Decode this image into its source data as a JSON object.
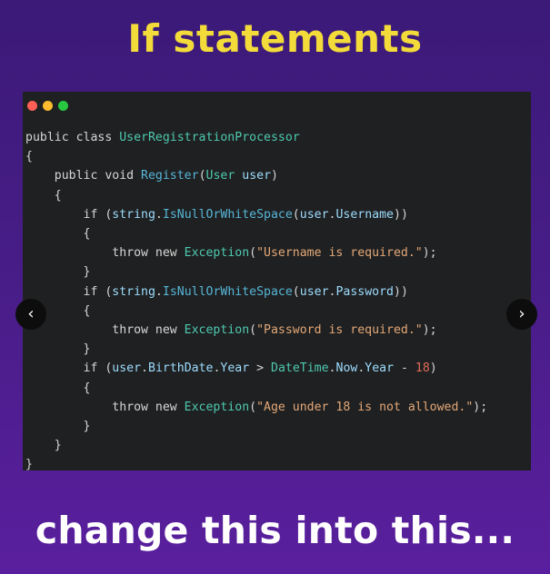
{
  "title": "If statements",
  "subtitle": "change this into this...",
  "window_dots": [
    {
      "name": "close",
      "color": "#ff5f57"
    },
    {
      "name": "minimize",
      "color": "#febc2e"
    },
    {
      "name": "maximize",
      "color": "#28c840"
    }
  ],
  "nav": {
    "prev_label": "‹",
    "next_label": "›",
    "prev_icon": "chevron-left-icon",
    "next_icon": "chevron-right-icon"
  },
  "colors": {
    "title": "#f3dc3a",
    "subtitle": "#ffffff",
    "editor_bg": "#1f2021",
    "type": "#4ec9b0",
    "method": "#56b6d8",
    "string": "#e3a878",
    "number": "#e06a5a"
  },
  "code_lines": [
    [
      {
        "t": "kw",
        "v": "public class "
      },
      {
        "t": "ty",
        "v": "UserRegistrationProcessor"
      }
    ],
    [
      {
        "t": "kw",
        "v": "{"
      }
    ],
    [
      {
        "t": "kw",
        "v": "    public void "
      },
      {
        "t": "fn",
        "v": "Register"
      },
      {
        "t": "kw",
        "v": "("
      },
      {
        "t": "ty",
        "v": "User"
      },
      {
        "t": "kw",
        "v": " "
      },
      {
        "t": "pr",
        "v": "user"
      },
      {
        "t": "kw",
        "v": ")"
      }
    ],
    [
      {
        "t": "kw",
        "v": "    {"
      }
    ],
    [
      {
        "t": "kw",
        "v": "        if ("
      },
      {
        "t": "pr",
        "v": "string"
      },
      {
        "t": "kw",
        "v": "."
      },
      {
        "t": "fn",
        "v": "IsNullOrWhiteSpace"
      },
      {
        "t": "kw",
        "v": "("
      },
      {
        "t": "pr",
        "v": "user"
      },
      {
        "t": "kw",
        "v": "."
      },
      {
        "t": "pr",
        "v": "Username"
      },
      {
        "t": "kw",
        "v": "))"
      }
    ],
    [
      {
        "t": "kw",
        "v": "        {"
      }
    ],
    [
      {
        "t": "kw",
        "v": "            throw new "
      },
      {
        "t": "ty",
        "v": "Exception"
      },
      {
        "t": "kw",
        "v": "("
      },
      {
        "t": "st",
        "v": "\"Username is required.\""
      },
      {
        "t": "kw",
        "v": ");"
      }
    ],
    [
      {
        "t": "kw",
        "v": "        }"
      }
    ],
    [
      {
        "t": "kw",
        "v": "        if ("
      },
      {
        "t": "pr",
        "v": "string"
      },
      {
        "t": "kw",
        "v": "."
      },
      {
        "t": "fn",
        "v": "IsNullOrWhiteSpace"
      },
      {
        "t": "kw",
        "v": "("
      },
      {
        "t": "pr",
        "v": "user"
      },
      {
        "t": "kw",
        "v": "."
      },
      {
        "t": "pr",
        "v": "Password"
      },
      {
        "t": "kw",
        "v": "))"
      }
    ],
    [
      {
        "t": "kw",
        "v": "        {"
      }
    ],
    [
      {
        "t": "kw",
        "v": "            throw new "
      },
      {
        "t": "ty",
        "v": "Exception"
      },
      {
        "t": "kw",
        "v": "("
      },
      {
        "t": "st",
        "v": "\"Password is required.\""
      },
      {
        "t": "kw",
        "v": ");"
      }
    ],
    [
      {
        "t": "kw",
        "v": "        }"
      }
    ],
    [
      {
        "t": "kw",
        "v": "        if ("
      },
      {
        "t": "pr",
        "v": "user"
      },
      {
        "t": "kw",
        "v": "."
      },
      {
        "t": "pr",
        "v": "BirthDate"
      },
      {
        "t": "kw",
        "v": "."
      },
      {
        "t": "pr",
        "v": "Year"
      },
      {
        "t": "kw",
        "v": " > "
      },
      {
        "t": "ty",
        "v": "DateTime"
      },
      {
        "t": "kw",
        "v": "."
      },
      {
        "t": "pr",
        "v": "Now"
      },
      {
        "t": "kw",
        "v": "."
      },
      {
        "t": "pr",
        "v": "Year"
      },
      {
        "t": "kw",
        "v": " - "
      },
      {
        "t": "nm",
        "v": "18"
      },
      {
        "t": "kw",
        "v": ")"
      }
    ],
    [
      {
        "t": "kw",
        "v": "        {"
      }
    ],
    [
      {
        "t": "kw",
        "v": "            throw new "
      },
      {
        "t": "ty",
        "v": "Exception"
      },
      {
        "t": "kw",
        "v": "("
      },
      {
        "t": "st",
        "v": "\"Age under 18 is not allowed.\""
      },
      {
        "t": "kw",
        "v": ");"
      }
    ],
    [
      {
        "t": "kw",
        "v": "        }"
      }
    ],
    [
      {
        "t": "kw",
        "v": "    }"
      }
    ],
    [
      {
        "t": "kw",
        "v": "}"
      }
    ]
  ]
}
